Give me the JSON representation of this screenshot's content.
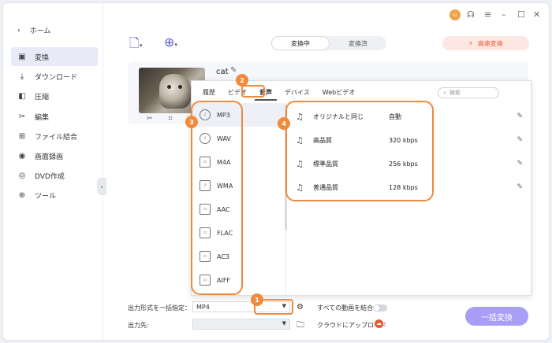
{
  "sidebar": {
    "home": "ホーム",
    "items": [
      {
        "label": "変換",
        "icon": "convert-icon"
      },
      {
        "label": "ダウンロード",
        "icon": "download-icon"
      },
      {
        "label": "圧縮",
        "icon": "compress-icon"
      },
      {
        "label": "編集",
        "icon": "scissors-icon"
      },
      {
        "label": "ファイル結合",
        "icon": "merge-icon"
      },
      {
        "label": "画面録画",
        "icon": "record-icon"
      },
      {
        "label": "DVD作成",
        "icon": "dvd-icon"
      },
      {
        "label": "ツール",
        "icon": "tools-icon"
      }
    ]
  },
  "topbar": {
    "avatar_initial": "u"
  },
  "toolbar": {
    "tabs": [
      "変換中",
      "変換済"
    ],
    "fast_convert": "高速変換"
  },
  "file": {
    "name": "cat"
  },
  "popup": {
    "tabs": [
      "履歴",
      "ビデオ",
      "音声",
      "デバイス",
      "Webビデオ"
    ],
    "active_tab": "音声",
    "search_placeholder": "検索",
    "formats": [
      "MP3",
      "WAV",
      "M4A",
      "WMA",
      "AAC",
      "FLAC",
      "AC3",
      "AIFF"
    ],
    "qualities": [
      {
        "name": "オリジナルと同じ",
        "rate": "自動"
      },
      {
        "name": "高品質",
        "rate": "320 kbps"
      },
      {
        "name": "標準品質",
        "rate": "256 kbps"
      },
      {
        "name": "普通品質",
        "rate": "128 kbps"
      }
    ]
  },
  "bottom": {
    "output_format_label": "出力形式を一括指定：",
    "output_format_value": "MP4",
    "merge_label": "すべての動画を結合",
    "output_path_label": "出力先:",
    "cloud_upload": "クラウドにアップロード",
    "convert_all": "一括変換"
  },
  "annotations": [
    "1",
    "2",
    "3",
    "4"
  ],
  "colors": {
    "accent": "#a89ef5",
    "annotation": "#f08a3c",
    "fast": "#e45c33"
  }
}
